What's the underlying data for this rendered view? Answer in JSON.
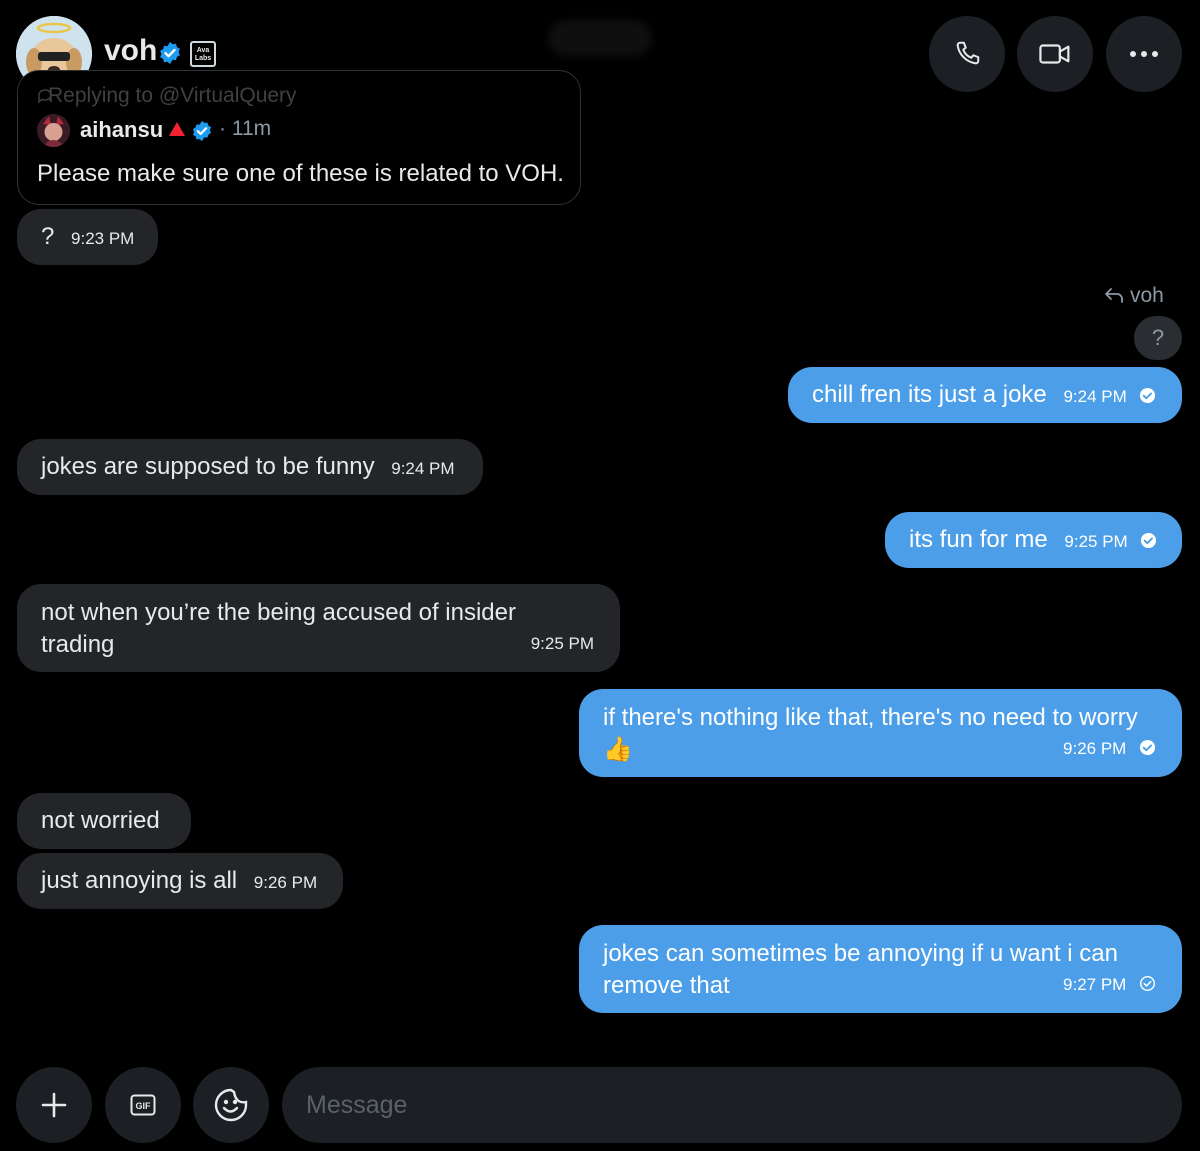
{
  "header": {
    "name": "voh",
    "affiliate_badge": "Ava Labs",
    "buttons": [
      "phone-icon",
      "video-icon",
      "more-icon"
    ]
  },
  "reply_card": {
    "replying_to": "Replying to @VirtualQuery",
    "user": "aihansu",
    "time": "· 11m",
    "text": "Please make sure one of these is related to VOH."
  },
  "messages": {
    "m1": {
      "text": "?",
      "time": "9:23 PM"
    },
    "reply_ref": "voh",
    "reply_ref_quote": "?",
    "m2": {
      "text": "chill fren its just a joke",
      "time": "9:24 PM"
    },
    "m3": {
      "text": "jokes are supposed to be funny",
      "time": "9:24 PM"
    },
    "m4": {
      "text": "its fun for me",
      "time": "9:25 PM"
    },
    "m5": {
      "text": "not when you’re the being accused of insider trading",
      "time": "9:25 PM"
    },
    "m6": {
      "text": "if there's nothing like that, there's no need to worry 👍",
      "time": "9:26 PM"
    },
    "m7": {
      "text": "not worried"
    },
    "m8": {
      "text": "just annoying is all",
      "time": "9:26 PM"
    },
    "m9": {
      "text": "jokes can sometimes be annoying if u want i can remove that",
      "time": "9:27 PM"
    }
  },
  "composer": {
    "placeholder": "Message",
    "gif_label": "GIF"
  },
  "colors": {
    "outgoing_bubble": "#4c9ee8",
    "incoming_bubble": "#232528",
    "background": "#000000",
    "verified": "#1d9bf0"
  }
}
